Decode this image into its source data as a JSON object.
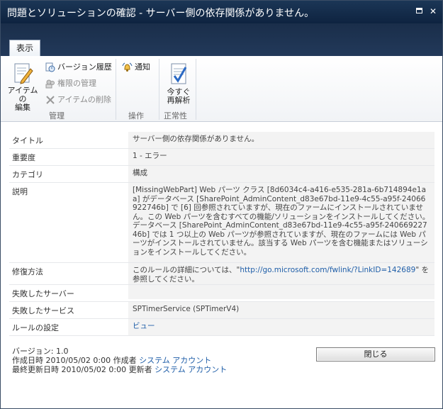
{
  "window": {
    "title": "問題とソリューションの確認 - サーバー側の依存関係がありません。"
  },
  "ribbon": {
    "tab_label": "表示",
    "edit_item_label_1": "アイテムの",
    "edit_item_label_2": "編集",
    "version_history": "バージョン履歴",
    "manage_permissions": "権限の管理",
    "delete_item": "アイテムの削除",
    "group_manage": "管理",
    "notify": "通知",
    "group_actions": "操作",
    "reanalyze_label_1": "今すぐ",
    "reanalyze_label_2": "再解析",
    "group_health": "正常性"
  },
  "properties": [
    {
      "label": "タイトル",
      "value": "サーバー側の依存関係がありません。"
    },
    {
      "label": "重要度",
      "value": "1 - エラー"
    },
    {
      "label": "カテゴリ",
      "value": "構成"
    },
    {
      "label": "説明",
      "value": "[MissingWebPart] Web パーツ クラス [8d6034c4-a416-e535-281a-6b714894e1aa] がデータベース [SharePoint_AdminContent_d83e67bd-11e9-4c55-a95f-24066922746b] で [6] 回参照されていますが、現在のファームにインストールされていません。この Web パーツを含むすべての機能/ソリューションをインストールしてください。データベース [SharePoint_AdminContent_d83e67bd-11e9-4c55-a95f-24066922746b] では 1 つ以上の Web パーツが参照されていますが、現在のファームには Web パーツがインストールされていません。該当する Web パーツを含む機能またはソリューションをインストールしてください。"
    },
    {
      "label": "修復方法",
      "value_prefix": " このルールの詳細については、\"",
      "value_link": "http://go.microsoft.com/fwlink/?LinkID=142689",
      "value_suffix": "\" を参照してください。"
    },
    {
      "label": "失敗したサーバー",
      "value": ""
    },
    {
      "label": "失敗したサービス",
      "value": "SPTimerService (SPTimerV4)"
    },
    {
      "label": "ルールの設定",
      "value": "ビュー"
    }
  ],
  "footer": {
    "version": "バージョン: 1.0",
    "created_prefix": "作成日時 2010/05/02 0:00 作成者",
    "created_by": "システム アカウント",
    "modified_prefix": "最終更新日時 2010/05/02 0:00 更新者",
    "modified_by": "システム アカウント",
    "close_label": "閉じる"
  }
}
